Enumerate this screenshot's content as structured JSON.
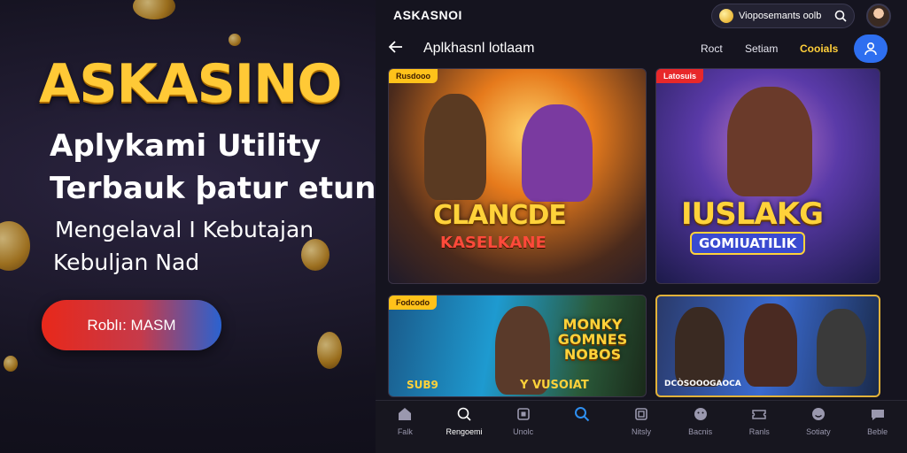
{
  "hero": {
    "logo": "ASKASINO",
    "line1": "Aplykami Utility",
    "line2": "Terbauk þatur etun",
    "line3": "Mengelaval I Kebutajan",
    "line4": "Kebuljan Nad",
    "cta_label": "Roblı: MASM"
  },
  "app": {
    "brand": "ASKASNOI",
    "search_text": "Vioposemants oolb",
    "nav_title": "Aplkhasnl lotlaam",
    "nav_links": [
      "Roct",
      "Setiam",
      "Cooials"
    ],
    "accent_color": "#2e6ff0",
    "highlight_color": "#ffcf3a"
  },
  "cards": [
    {
      "tag": "Rusdooo",
      "title": "CLANCDE",
      "subtitle": "KASELKANE"
    },
    {
      "tag": "Latosuis",
      "title": "IUSLAKG",
      "subtitle": "GOMIUATILIK"
    },
    {
      "tag": "Fodcodo",
      "title": "MONKY GOMNES NOBOS",
      "subtitle": "Y VUSOIAT",
      "subtitle2": "SUB9"
    },
    {
      "tag": "",
      "title": "",
      "subtitle": "DCÒSOOOGAOCA"
    }
  ],
  "bottom_nav": [
    {
      "icon": "home-icon",
      "label": "Falk"
    },
    {
      "icon": "search-circle-icon",
      "label": "Rengoemi"
    },
    {
      "icon": "square-icon",
      "label": "Unolc"
    },
    {
      "icon": "search-icon",
      "label": ""
    },
    {
      "icon": "box-icon",
      "label": "Nitsly"
    },
    {
      "icon": "face-icon",
      "label": "Bacnis"
    },
    {
      "icon": "ticket-icon",
      "label": "Ranls"
    },
    {
      "icon": "smile-icon",
      "label": "Sotiaty"
    },
    {
      "icon": "chat-icon",
      "label": "Beble"
    }
  ]
}
